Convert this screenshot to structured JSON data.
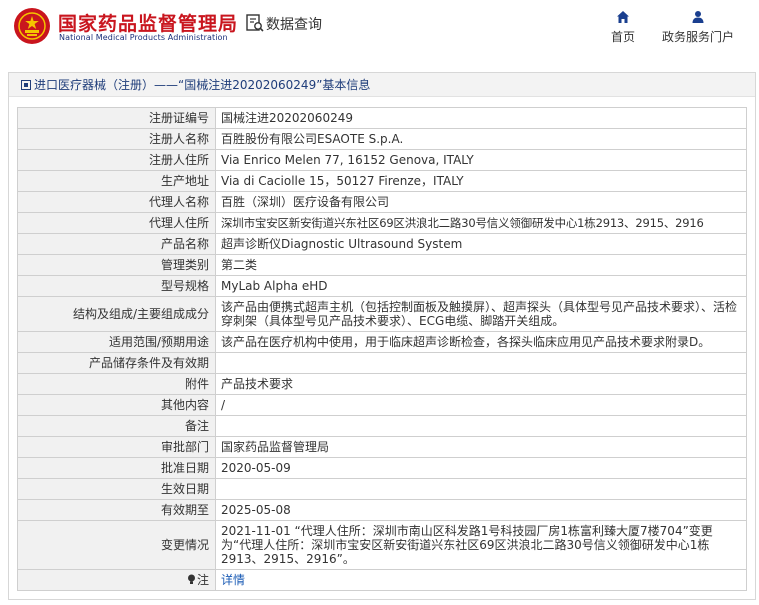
{
  "header": {
    "site_name_cn": "国家药品监督管理局",
    "site_name_en": "National Medical Products Administration",
    "query_label": "数据查询",
    "nav": [
      {
        "label": "首页",
        "icon": "home-icon"
      },
      {
        "label": "政务服务门户",
        "icon": "user-icon"
      }
    ],
    "brand_color": "#c9151e",
    "nav_icon_color": "#1a3f8f"
  },
  "breadcrumb": {
    "text": "进口医疗器械（注册）——“国械注进20202060249”基本信息"
  },
  "detail_rows": [
    {
      "label": "注册证编号",
      "value": "国械注进20202060249"
    },
    {
      "label": "注册人名称",
      "value": "百胜股份有限公司ESAOTE S.p.A."
    },
    {
      "label": "注册人住所",
      "value": "Via Enrico Melen 77, 16152 Genova, ITALY"
    },
    {
      "label": "生产地址",
      "value": "Via di Caciolle 15，50127 Firenze，ITALY"
    },
    {
      "label": "代理人名称",
      "value": "百胜（深圳）医疗设备有限公司"
    },
    {
      "label": "代理人住所",
      "value": "深圳市宝安区新安街道兴东社区69区洪浪北二路30号信义领御研发中心1栋2913、2915、2916"
    },
    {
      "label": "产品名称",
      "value": "超声诊断仪Diagnostic Ultrasound System"
    },
    {
      "label": "管理类别",
      "value": "第二类"
    },
    {
      "label": "型号规格",
      "value": "MyLab Alpha eHD"
    },
    {
      "label": "结构及组成/主要组成成分",
      "value": "该产品由便携式超声主机（包括控制面板及触摸屏）、超声探头（具体型号见产品技术要求）、活检穿刺架（具体型号见产品技术要求）、ECG电缆、脚踏开关组成。"
    },
    {
      "label": "适用范围/预期用途",
      "value": "该产品在医疗机构中使用，用于临床超声诊断检查，各探头临床应用见产品技术要求附录D。"
    },
    {
      "label": "产品储存条件及有效期",
      "value": ""
    },
    {
      "label": "附件",
      "value": "产品技术要求"
    },
    {
      "label": "其他内容",
      "value": "/"
    },
    {
      "label": "备注",
      "value": ""
    },
    {
      "label": "审批部门",
      "value": "国家药品监督管理局"
    },
    {
      "label": "批准日期",
      "value": "2020-05-09"
    },
    {
      "label": "生效日期",
      "value": ""
    },
    {
      "label": "有效期至",
      "value": "2025-05-08"
    },
    {
      "label": "变更情况",
      "value": "2021-11-01 “代理人住所：深圳市南山区科发路1号科技园厂房1栋富利臻大厦7楼704”变更为“代理人住所：深圳市宝安区新安街道兴东社区69区洪浪北二路30号信义领御研发中心1栋2913、2915、2916”。"
    }
  ],
  "note_row": {
    "label": "注",
    "link_text": "详情"
  }
}
